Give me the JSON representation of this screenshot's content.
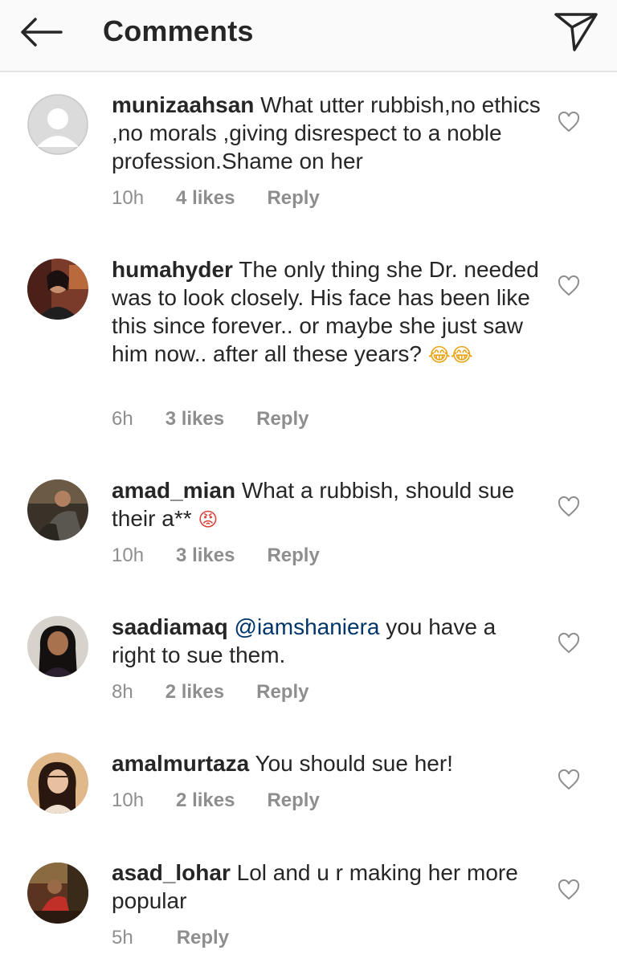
{
  "header": {
    "title": "Comments"
  },
  "comments": [
    {
      "username": "munizaahsan",
      "text": "What utter rubbish,no ethics ,no morals ,giving disrespect to a noble profession.Shame on her",
      "time": "10h",
      "likes": "4 likes",
      "reply": "Reply"
    },
    {
      "username": "humahyder",
      "text": "The only thing she Dr. needed was to look closely. His face has been like this since forever.. or maybe she just saw him now.. after all these years?",
      "emoji": "😂😂",
      "time": "6h",
      "likes": "3 likes",
      "reply": "Reply"
    },
    {
      "username": "amad_mian",
      "text": "What a rubbish, should sue their a**",
      "emoji": "😡",
      "time": "10h",
      "likes": "3 likes",
      "reply": "Reply"
    },
    {
      "username": "saadiamaq",
      "mention": "@iamshaniera",
      "text": "you have a right to sue them.",
      "time": "8h",
      "likes": "2 likes",
      "reply": "Reply"
    },
    {
      "username": "amalmurtaza",
      "text": "You should sue her!",
      "time": "10h",
      "likes": "2 likes",
      "reply": "Reply"
    },
    {
      "username": "asad_lohar",
      "text": "Lol and u r making her more popular",
      "time": "5h",
      "reply": "Reply"
    }
  ],
  "colors": {
    "text": "#262626",
    "meta": "#8e8e8e",
    "mention": "#003569",
    "header_bg": "#fafafa"
  },
  "icons": [
    "back-arrow-icon",
    "send-icon",
    "heart-icon"
  ]
}
